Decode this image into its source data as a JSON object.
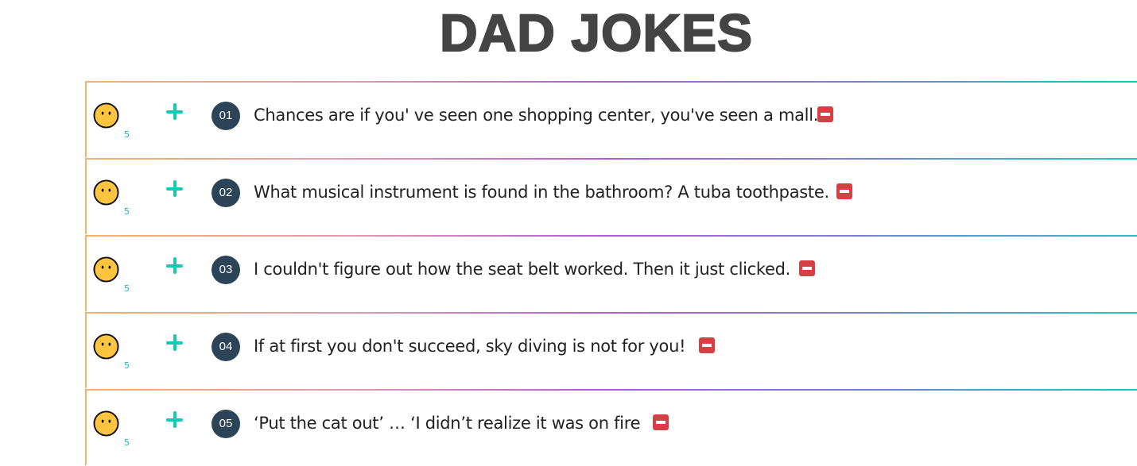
{
  "title": "DAD JOKES",
  "colors": {
    "title": "#444444",
    "plus": "#16c9b3",
    "badge": "#2c4458",
    "delete": "#d64045",
    "score": "#19b5c7",
    "face": "#fcc43f"
  },
  "jokes": [
    {
      "number": "01",
      "text": "Chances are if you' ve seen one shopping center, you've seen a mall.",
      "score": "5",
      "face_icon": "neutral-face-icon"
    },
    {
      "number": "02",
      "text": "What musical instrument is found in the bathroom? A tuba toothpaste.",
      "score": "5",
      "face_icon": "neutral-face-icon"
    },
    {
      "number": "03",
      "text": "I couldn't figure out how the seat belt worked. Then it just clicked.",
      "score": "5",
      "face_icon": "neutral-face-icon"
    },
    {
      "number": "04",
      "text": "If at first you don't succeed, sky diving is not for you!",
      "score": "5",
      "face_icon": "neutral-face-icon"
    },
    {
      "number": "05",
      "text": "‘Put the cat out’ … ‘I didn’t realize it was on fire",
      "score": "5",
      "face_icon": "neutral-face-icon"
    }
  ]
}
